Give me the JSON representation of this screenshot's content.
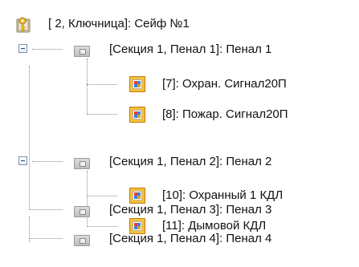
{
  "tree": {
    "root": {
      "label": "[ 2, Ключница]: Сейф №1",
      "icon": "key-box-icon"
    },
    "sections": [
      {
        "label": "[Секция 1, Пенал 1]: Пенал 1",
        "icon": "section-box-icon",
        "expanded": true,
        "children": [
          {
            "label": "[7]: Охран. Сигнал20П",
            "icon": "sensor-icon"
          },
          {
            "label": "[8]: Пожар. Сигнал20П",
            "icon": "sensor-icon"
          }
        ]
      },
      {
        "label": "[Секция 1, Пенал 2]: Пенал 2",
        "icon": "section-box-icon",
        "expanded": true,
        "children": [
          {
            "label": "[10]: Охранный 1 КДЛ",
            "icon": "sensor-icon"
          },
          {
            "label": "[11]: Дымовой КДЛ",
            "icon": "sensor-icon"
          }
        ]
      },
      {
        "label": "[Секция 1, Пенал 3]: Пенал 3",
        "icon": "section-box-icon",
        "expanded": false
      },
      {
        "label": "[Секция 1, Пенал 4]: Пенал 4",
        "icon": "section-box-icon",
        "expanded": false
      }
    ]
  }
}
